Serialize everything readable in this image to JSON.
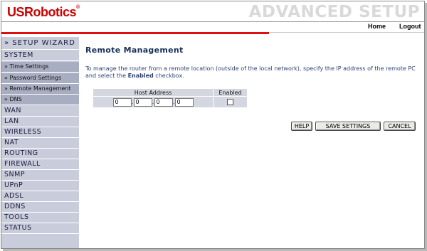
{
  "header": {
    "logo_us": "US",
    "logo_robotics": "Robotics",
    "logo_tm": "®",
    "title": "ADVANCED SETUP",
    "nav": {
      "home": "Home",
      "logout": "Logout"
    }
  },
  "sidebar": {
    "wizard": "» SETUP WIZARD",
    "items": [
      {
        "label": "SYSTEM"
      },
      {
        "label": "» Time Settings"
      },
      {
        "label": "» Password Settings"
      },
      {
        "label": "» Remote Management"
      },
      {
        "label": "» DNS"
      },
      {
        "label": "WAN"
      },
      {
        "label": "LAN"
      },
      {
        "label": "WIRELESS"
      },
      {
        "label": "NAT"
      },
      {
        "label": "ROUTING"
      },
      {
        "label": "FIREWALL"
      },
      {
        "label": "SNMP"
      },
      {
        "label": "UPnP"
      },
      {
        "label": "ADSL"
      },
      {
        "label": "DDNS"
      },
      {
        "label": "TOOLS"
      },
      {
        "label": "STATUS"
      }
    ]
  },
  "main": {
    "title": "Remote Management",
    "description_pre": "To manage the router from a remote location (outside of the local network), specify the IP address of the remote PC and select the ",
    "description_bold": "Enabled",
    "description_post": " checkbox.",
    "table": {
      "col_host": "Host Address",
      "col_enabled": "Enabled",
      "ip": [
        "0",
        "0",
        "0",
        "0"
      ],
      "enabled": false
    },
    "buttons": {
      "help": "HELP",
      "save": "SAVE SETTINGS",
      "cancel": "CANCEL"
    }
  }
}
